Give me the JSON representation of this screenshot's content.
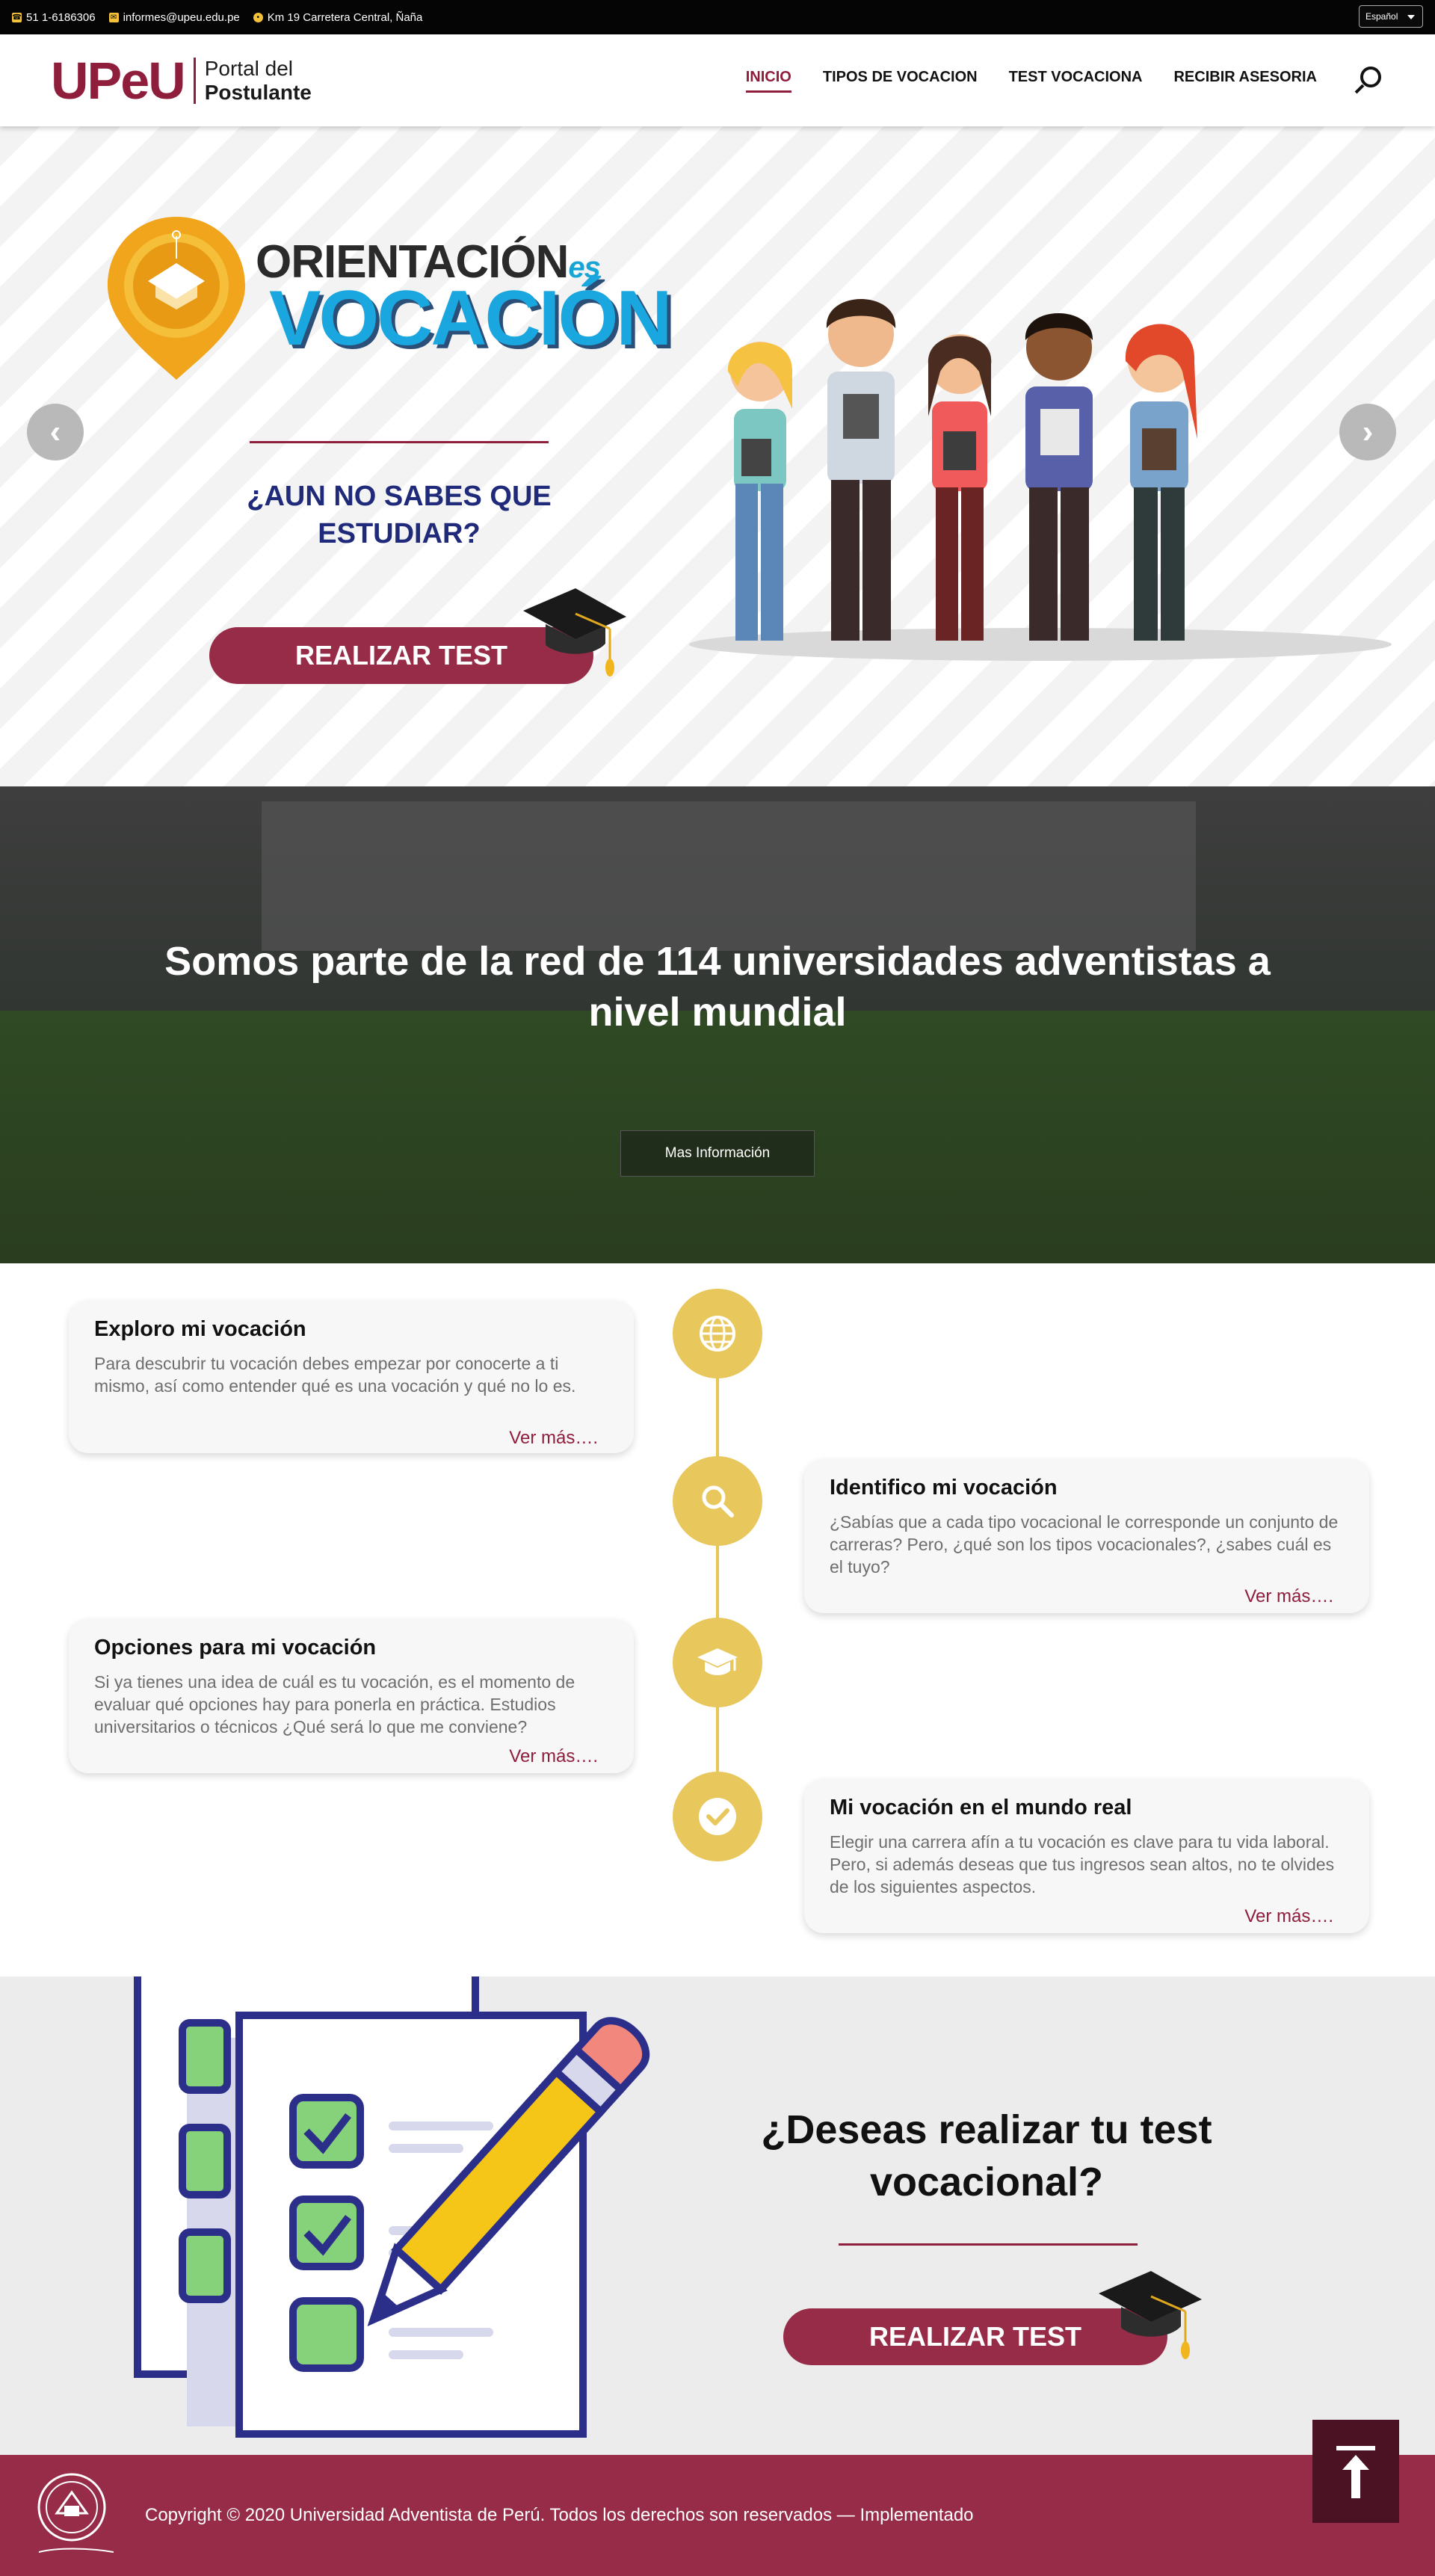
{
  "topbar": {
    "phone": "51 1-6186306",
    "email": "informes@upeu.edu.pe",
    "address": "Km 19 Carretera Central, Ñaña",
    "language": "Español"
  },
  "header": {
    "brand": "UPeU",
    "portal_line1": "Portal del",
    "portal_line2": "Postulante",
    "menu": [
      {
        "label": "INICIO",
        "active": true
      },
      {
        "label": "TIPOS DE VOCACION",
        "active": false
      },
      {
        "label": "TEST VOCACIONA",
        "active": false
      },
      {
        "label": "RECIBIR ASESORIA",
        "active": false
      }
    ]
  },
  "hero": {
    "title_top": "ORIENTACIÓN",
    "title_es": "es",
    "title_bottom": "VOCACIÓN",
    "question": "¿AUN NO SABES QUE ESTUDIAR?",
    "button": "REALIZAR TEST",
    "prev": "‹",
    "next": "›"
  },
  "band": {
    "headline": "Somos parte de la red de 114 universidades adventistas a nivel mundial",
    "button": "Mas Información"
  },
  "timeline": [
    {
      "title": "Exploro mi vocación",
      "text": "Para descubrir tu vocación debes empezar por conocerte a ti mismo, así como entender qué es una vocación y qué no lo es.",
      "more": "Ver más….",
      "icon": "globe-icon"
    },
    {
      "title": "Identifico mi vocación",
      "text": "¿Sabías que a cada tipo vocacional le corresponde un conjunto de carreras? Pero, ¿qué son los tipos vocacionales?, ¿sabes cuál es el tuyo?",
      "more": "Ver más….",
      "icon": "search-icon"
    },
    {
      "title": "Opciones para mi vocación",
      "text": "Si ya tienes una idea de cuál es tu vocación, es el momento de evaluar qué opciones hay para ponerla en práctica. Estudios universitarios o técnicos ¿Qué será lo que me conviene?",
      "more": "Ver más….",
      "icon": "graduation-cap-icon"
    },
    {
      "title": "Mi vocación en el mundo real",
      "text": "Elegir una carrera afín a tu vocación es clave para tu vida laboral. Pero, si además deseas que tus ingresos sean altos, no te olvides de los siguientes aspectos.",
      "more": "Ver más….",
      "icon": "check-circle-icon"
    }
  ],
  "cta": {
    "headline": "¿Deseas realizar tu test vocacional?",
    "button": "REALIZAR TEST"
  },
  "footer": {
    "copyright": "Copyright © 2020 Universidad Adventista de Perú. Todos los derechos son reservados — Implementado"
  },
  "colors": {
    "brand": "#8f1d3c",
    "button": "#962c47",
    "accent_yellow": "#e8c75d",
    "navy": "#1f2a7a"
  }
}
